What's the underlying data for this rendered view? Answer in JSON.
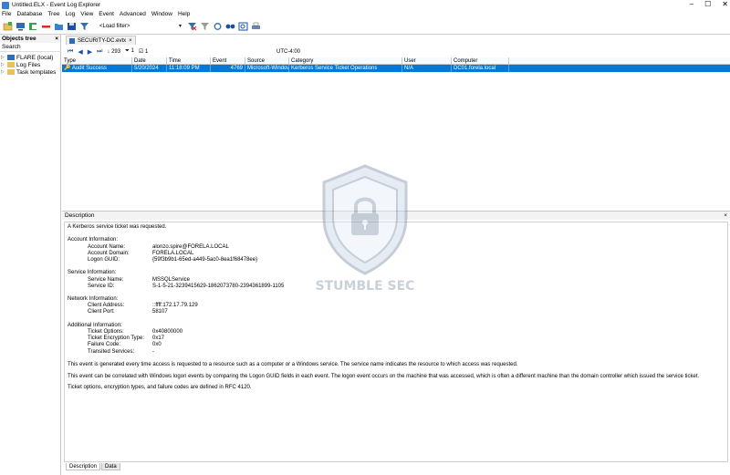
{
  "window": {
    "title": "Untitled.ELX - Event Log Explorer",
    "minimize": "–",
    "maximize": "☐",
    "close": "✕"
  },
  "menu": [
    "File",
    "Database",
    "Tree",
    "Log",
    "View",
    "Event",
    "Advanced",
    "Window",
    "Help"
  ],
  "toolbar": {
    "load_filter": "<Load filter>"
  },
  "objects_tree": {
    "title": "Objects tree",
    "close": "×",
    "search": "Search",
    "items": [
      {
        "label": "FLARE (local)",
        "icon": "computer-icon"
      },
      {
        "label": "Log Files",
        "icon": "folder-icon"
      },
      {
        "label": "Task templates",
        "icon": "folder-icon"
      }
    ]
  },
  "document_tab": {
    "label": "SECURITY-DC.evtx",
    "close": "×"
  },
  "nav": {
    "count": "293",
    "filter_count": "1",
    "checked_count": "1",
    "timezone": "UTC-4:00"
  },
  "table": {
    "columns": [
      "Type",
      "Date",
      "Time",
      "Event",
      "Source",
      "Category",
      "User",
      "Computer"
    ],
    "rows": [
      {
        "type": "Audit Success",
        "date": "5/20/2024",
        "time": "11:18:09 PM",
        "event": "4769",
        "source": "Microsoft-Windows",
        "category": "Kerberos Service Ticket Operations",
        "user": "N/A",
        "computer": "DC01.forela.local"
      }
    ]
  },
  "description": {
    "title": "Description",
    "close": "×",
    "headline": "A Kerberos service ticket was requested.",
    "account_header": "Account Information:",
    "account_name_k": "Account Name:",
    "account_name_v": "alonzo.spire@FORELA.LOCAL",
    "account_domain_k": "Account Domain:",
    "account_domain_v": "FORELA.LOCAL",
    "logon_guid_k": "Logon GUID:",
    "logon_guid_v": "{59f3b9b1-65ed-a449-5ac0-8ea1f68478ee}",
    "service_header": "Service Information:",
    "service_name_k": "Service Name:",
    "service_name_v": "MSSQLService",
    "service_id_k": "Service ID:",
    "service_id_v": "S-1-5-21-3239415629-1862073780-2394361899-1105",
    "network_header": "Network Information:",
    "client_address_k": "Client Address:",
    "client_address_v": "::ffff:172.17.79.129",
    "client_port_k": "Client Port:",
    "client_port_v": "58107",
    "additional_header": "Additional Information:",
    "ticket_options_k": "Ticket Options:",
    "ticket_options_v": "0x40800000",
    "encryption_k": "Ticket Encryption Type:",
    "encryption_v": "0x17",
    "failure_k": "Failure Code:",
    "failure_v": "0x0",
    "transited_k": "Transited Services:",
    "transited_v": "-",
    "para1": "This event is generated every time access is requested to a resource such as a computer or a Windows service.  The service name indicates the resource to which access was requested.",
    "para2": "This event can be correlated with Windows logon events by comparing the Logon GUID fields in each event.  The logon event occurs on the machine that was accessed, which is often a different machine than the domain controller which issued the service ticket.",
    "para3": "Ticket options, encryption types, and failure codes are defined in RFC 4120."
  },
  "bottom_tabs": [
    "Description",
    "Data"
  ],
  "watermark": {
    "text": "STUMBLE SEC"
  },
  "colors": {
    "selection": "#0078d7",
    "accent": "#1f4fa0"
  }
}
